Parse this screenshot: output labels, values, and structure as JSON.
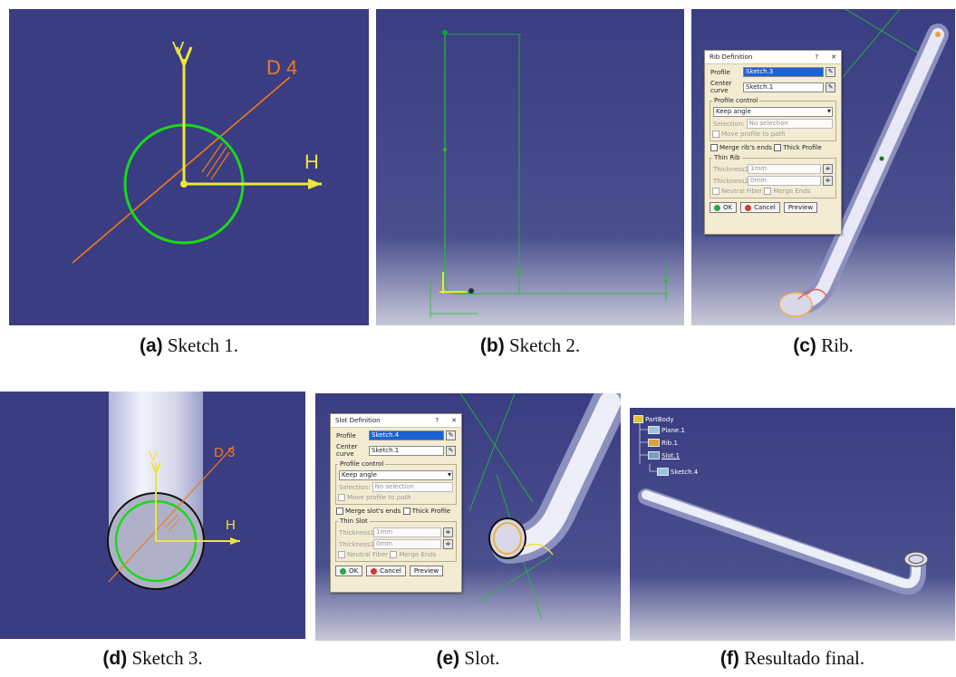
{
  "captions": [
    {
      "label": "(a)",
      "text": "Sketch 1."
    },
    {
      "label": "(b)",
      "text": "Sketch 2."
    },
    {
      "label": "(c)",
      "text": "Rib."
    },
    {
      "label": "(d)",
      "text": "Sketch 3."
    },
    {
      "label": "(e)",
      "text": "Slot."
    },
    {
      "label": "(f)",
      "text": "Resultado final."
    }
  ],
  "sketch1": {
    "axis_v": "V",
    "axis_h": "H",
    "dim": "D 4"
  },
  "sketch3": {
    "axis_v": "V",
    "axis_h": "H",
    "dim": "D 3"
  },
  "rib_dialog": {
    "title": "Rib Definition",
    "help": "?",
    "close": "✕",
    "profile_label": "Profile",
    "profile_value": "Sketch.3",
    "center_label": "Center curve",
    "center_value": "Sketch.1",
    "profile_control": "Profile control",
    "mode": "Keep angle",
    "selection_label": "Selection:",
    "selection_value": "No selection",
    "move_profile": "Move profile to path",
    "merge_ends": "Merge rib's ends",
    "thick_profile": "Thick Profile",
    "thin_group": "Thin Rib",
    "thickness1_label": "Thickness1:",
    "thickness1_value": "1mm",
    "thickness2_label": "Thickness2:",
    "thickness2_value": "0mm",
    "neutral_fiber": "Neutral Fiber",
    "merge_ends2": "Merge Ends",
    "ok": "OK",
    "cancel": "Cancel",
    "preview": "Preview"
  },
  "slot_dialog": {
    "title": "Slot Definition",
    "help": "?",
    "close": "✕",
    "profile_label": "Profile",
    "profile_value": "Sketch.4",
    "center_label": "Center curve",
    "center_value": "Sketch.1",
    "profile_control": "Profile control",
    "mode": "Keep angle",
    "selection_label": "Selection:",
    "selection_value": "No selection",
    "move_profile": "Move profile to path",
    "merge_ends": "Merge slot's ends",
    "thick_profile": "Thick Profile",
    "thin_group": "Thin Slot",
    "thickness1_label": "Thickness1:",
    "thickness1_value": "1mm",
    "thickness2_label": "Thickness2:",
    "thickness2_value": "0mm",
    "neutral_fiber": "Neutral Fiber",
    "merge_ends2": "Merge Ends",
    "ok": "OK",
    "cancel": "Cancel",
    "preview": "Preview"
  },
  "tree": {
    "root": "PartBody",
    "items": [
      "Plane.1",
      "Rib.1",
      "Slot.1",
      "Sketch.4"
    ]
  },
  "colors": {
    "viewport_blue": "#3a3d82",
    "sketch_green": "#19d81c",
    "axis_yellow": "#ece63a",
    "dimension_orange": "#ef7b1c",
    "dialog_bg": "#f3ecd2",
    "select_blue": "#1c62d4"
  }
}
